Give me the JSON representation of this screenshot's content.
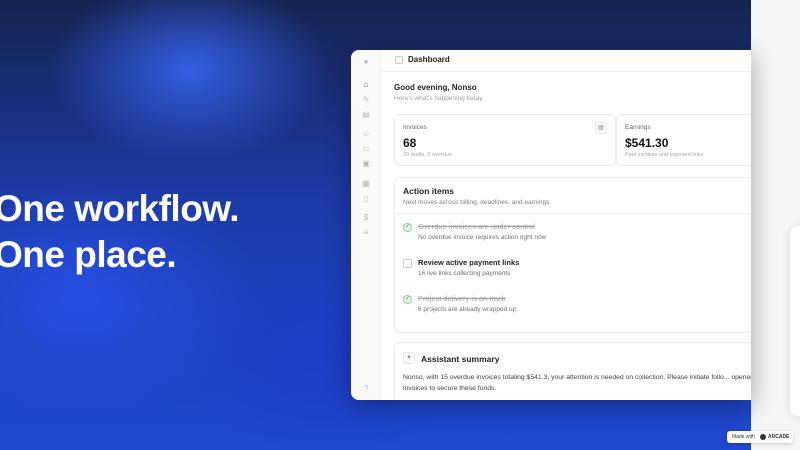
{
  "hero": {
    "line1": "One workflow.",
    "line2": "One place."
  },
  "window": {
    "title": "Dashboard",
    "greeting": "Good evening, Nonso",
    "subtitle": "Here's what's happening today."
  },
  "sidebar": {
    "icons": [
      "logo-icon",
      "home-icon",
      "pen-icon",
      "inbox-icon",
      "users-icon",
      "folder-icon",
      "card-icon",
      "calendar-icon",
      "receipt-icon",
      "dollar-icon",
      "settings-icon",
      "help-icon"
    ]
  },
  "stats": {
    "invoices": {
      "label": "Invoices",
      "value": "68",
      "note": "29 drafts, 0 overdue"
    },
    "earnings": {
      "label": "Earnings",
      "value": "$541.30",
      "note": "Paid invoices and payment links"
    }
  },
  "action_items": {
    "title": "Action items",
    "subtitle": "Next moves across billing, deadlines, and earnings.",
    "items": [
      {
        "title": "Overdue invoices are under control",
        "desc": "No overdue invoice requires action right now",
        "done": true
      },
      {
        "title": "Review active payment links",
        "desc": "16 live links collecting payments",
        "done": false
      },
      {
        "title": "Project delivery is on track",
        "desc": "6 projects are already wrapped up",
        "done": true
      }
    ]
  },
  "assistant": {
    "title": "Assistant summary",
    "body": "Nonso, with 15 overdue invoices totaling $541.3, your attention is needed on collection. Please initiate follo... opened invoices to secure these funds."
  },
  "badge": {
    "made_with": "Made with",
    "brand": "ARCADE"
  },
  "colors": {
    "accent_blue": "#1e48d0",
    "done_green": "#2f9e62"
  }
}
